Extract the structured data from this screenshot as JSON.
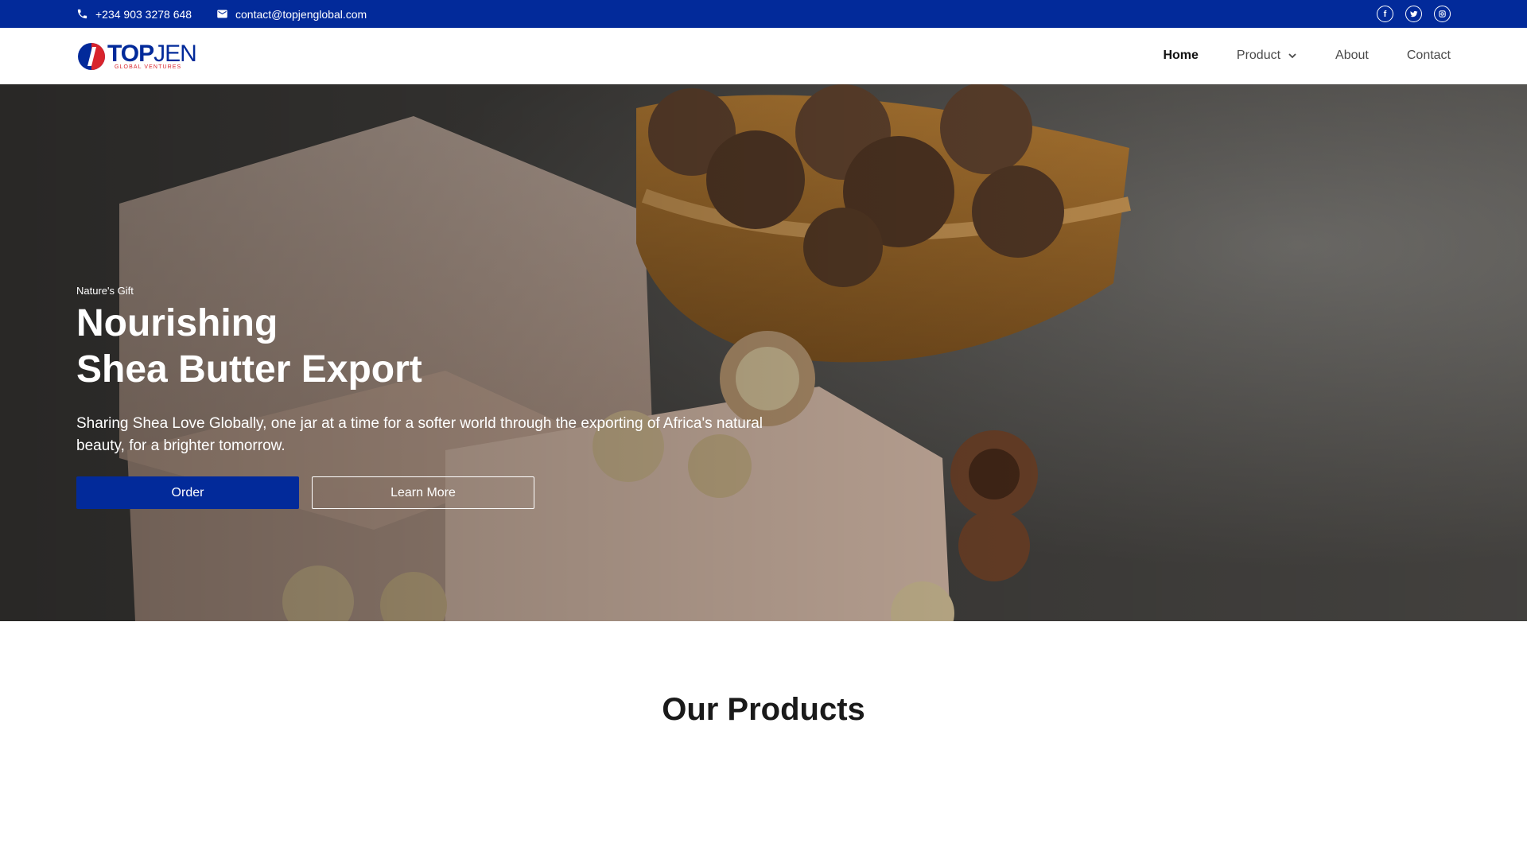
{
  "topbar": {
    "phone": "+234 903 3278 648",
    "email": "contact@topjenglobal.com",
    "social": [
      "facebook-icon",
      "twitter-icon",
      "instagram-icon"
    ]
  },
  "logo": {
    "word_bold": "TOP",
    "word_regular": "JEN",
    "tagline": "GLOBAL VENTURES"
  },
  "nav": {
    "items": [
      {
        "label": "Home",
        "active": true
      },
      {
        "label": "Product"
      },
      {
        "label": "About"
      },
      {
        "label": "Contact"
      }
    ]
  },
  "hero": {
    "eyebrow": "Nature's Gift",
    "title_line1": "Nourishing",
    "title_line2": "Shea Butter Export",
    "description": "Sharing Shea Love Globally, one jar at a time for a softer world through the exporting of Africa's natural beauty, for a brighter tomorrow.",
    "primary_button": "Order",
    "secondary_button": "Learn More"
  },
  "products": {
    "title": "Our Products"
  },
  "colors": {
    "brand_blue": "#022a9a",
    "brand_red": "#d8242c"
  }
}
